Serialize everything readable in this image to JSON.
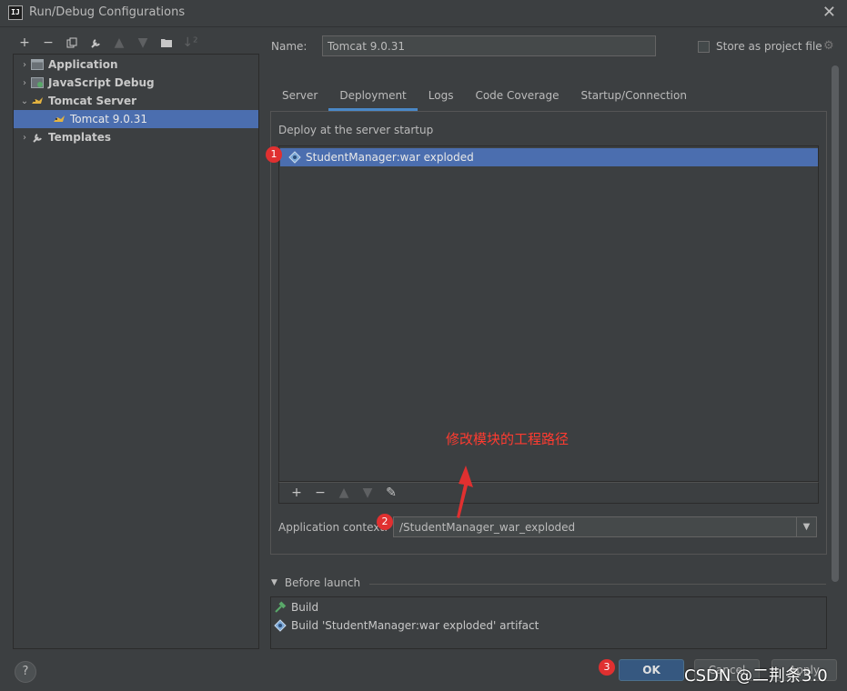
{
  "window": {
    "title": "Run/Debug Configurations",
    "logo_text": "IJ"
  },
  "left_toolbar": [
    "add-icon",
    "remove-icon",
    "copy-icon",
    "wrench-icon",
    "up-icon",
    "down-icon",
    "folder-icon",
    "sort-icon"
  ],
  "tree": [
    {
      "label": "Application",
      "bold": true,
      "expanded": false
    },
    {
      "label": "JavaScript Debug",
      "bold": true,
      "expanded": false
    },
    {
      "label": "Tomcat Server",
      "bold": true,
      "expanded": true
    },
    {
      "label": "Tomcat 9.0.31",
      "bold": false,
      "selected": true
    },
    {
      "label": "Templates",
      "bold": true,
      "expanded": false
    }
  ],
  "form": {
    "name_label": "Name:",
    "name_value": "Tomcat 9.0.31",
    "store_label": "Store as project file",
    "store_checked": false
  },
  "tabs": [
    {
      "label": "Server",
      "active": false
    },
    {
      "label": "Deployment",
      "active": true
    },
    {
      "label": "Logs",
      "active": false
    },
    {
      "label": "Code Coverage",
      "active": false
    },
    {
      "label": "Startup/Connection",
      "active": false
    }
  ],
  "deployment": {
    "section_label": "Deploy at the server startup",
    "artifacts": [
      "StudentManager:war exploded"
    ],
    "context_label": "Application context:",
    "context_value": "/StudentManager_war_exploded"
  },
  "before_launch": {
    "label": "Before launch",
    "items": [
      "Build",
      "Build 'StudentManager:war exploded' artifact"
    ]
  },
  "buttons": {
    "help": "?",
    "ok": "OK",
    "cancel": "Cancel",
    "apply": "Apply"
  },
  "annotations": {
    "badge1": "1",
    "badge2": "2",
    "badge3": "3",
    "note": "修改模块的工程路径",
    "watermark": "CSDN @二荆条3.0"
  },
  "colors": {
    "selection": "#4b6eaf",
    "accent_tab": "#4a88c7",
    "annotation": "#e03030",
    "background": "#3c3f41"
  }
}
